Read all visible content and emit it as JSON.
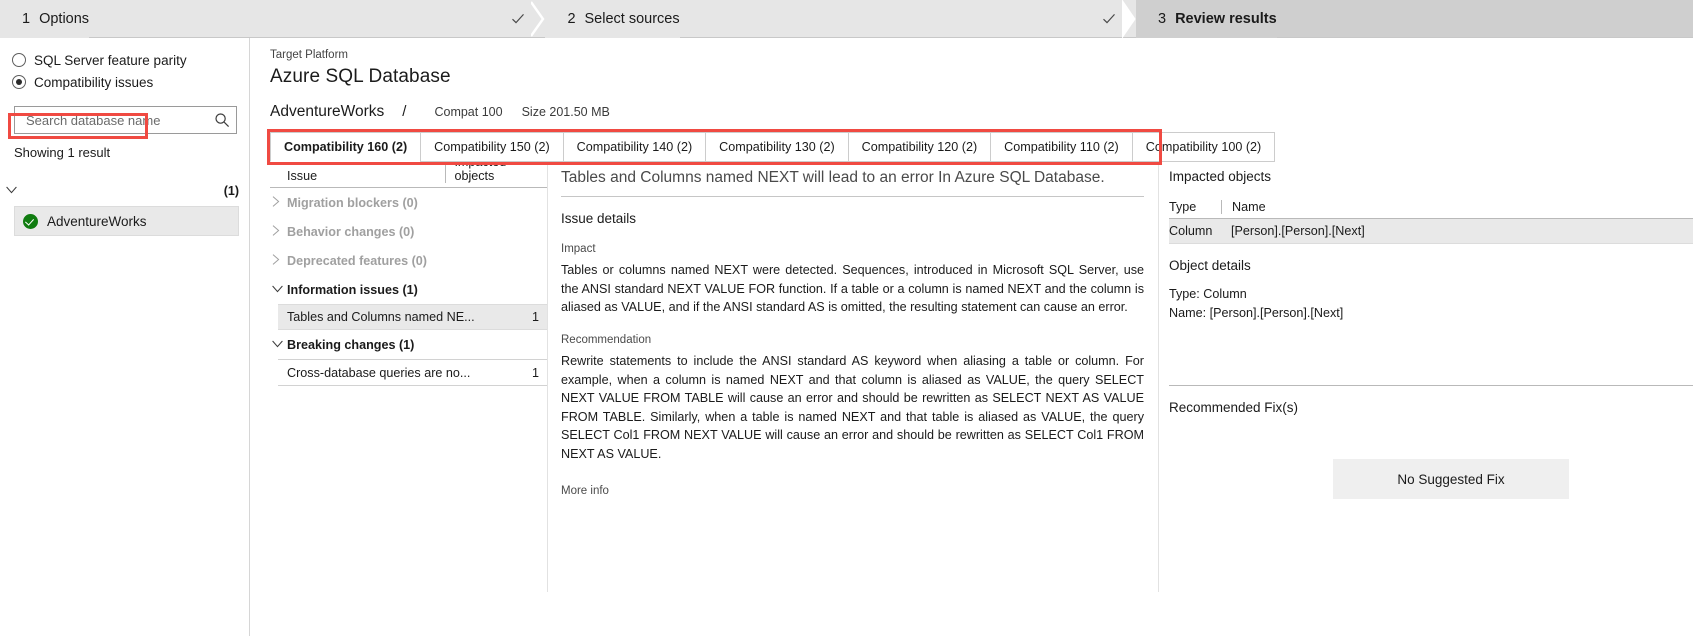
{
  "wizard": {
    "steps": [
      {
        "num": "1",
        "label": "Options",
        "active": false,
        "checked": true
      },
      {
        "num": "2",
        "label": "Select sources",
        "active": false,
        "checked": true
      },
      {
        "num": "3",
        "label": "Review results",
        "active": true,
        "checked": false
      }
    ]
  },
  "sidebar": {
    "radios": [
      {
        "label": "SQL Server feature parity",
        "selected": false
      },
      {
        "label": "Compatibility issues",
        "selected": true
      }
    ],
    "search": {
      "value": "",
      "placeholder": "Search database name",
      "icon": "search-icon"
    },
    "showing": "Showing 1 result",
    "group": {
      "name": "",
      "count": "(1)",
      "expanded": true
    },
    "databases": [
      {
        "name": "AdventureWorks",
        "status": "ok"
      }
    ]
  },
  "main": {
    "target_kicker": "Target Platform",
    "target_name": "Azure SQL Database",
    "db": {
      "name": "AdventureWorks",
      "separator": "/",
      "compat": "Compat 100",
      "size": "Size 201.50 MB"
    },
    "tabs": [
      {
        "label": "Compatibility 160 (2)",
        "active": true
      },
      {
        "label": "Compatibility 150 (2)",
        "active": false
      },
      {
        "label": "Compatibility 140 (2)",
        "active": false
      },
      {
        "label": "Compatibility 130 (2)",
        "active": false
      },
      {
        "label": "Compatibility 120 (2)",
        "active": false
      },
      {
        "label": "Compatibility 110 (2)",
        "active": false
      },
      {
        "label": "Compatibility 100 (2)",
        "active": false
      }
    ],
    "issues": {
      "col_issue": "Issue",
      "col_impacted": "Impacted objects",
      "categories": [
        {
          "label": "Migration blockers (0)",
          "expanded": false,
          "dim": true,
          "items": []
        },
        {
          "label": "Behavior changes (0)",
          "expanded": false,
          "dim": true,
          "items": []
        },
        {
          "label": "Deprecated features (0)",
          "expanded": false,
          "dim": true,
          "items": []
        },
        {
          "label": "Information issues (1)",
          "expanded": true,
          "dim": false,
          "items": [
            {
              "name": "Tables and Columns named NE...",
              "count": "1",
              "selected": true
            }
          ]
        },
        {
          "label": "Breaking changes (1)",
          "expanded": true,
          "dim": false,
          "items": [
            {
              "name": "Cross-database queries are no...",
              "count": "1",
              "selected": false
            }
          ]
        }
      ]
    },
    "detail": {
      "title": "Tables and Columns named NEXT will lead to an error In Azure SQL Database.",
      "section": "Issue details",
      "impact_label": "Impact",
      "impact_text": "Tables or columns named NEXT were detected. Sequences, introduced in Microsoft SQL Server, use the ANSI standard NEXT VALUE FOR function. If a table or a column is named NEXT and the column is aliased as VALUE, and if the ANSI standard AS is omitted, the resulting statement can cause an error.",
      "recommendation_label": "Recommendation",
      "recommendation_text": "Rewrite statements to include the ANSI standard AS keyword when aliasing a table or column. For example, when a column is named NEXT and that column is aliased as VALUE, the query SELECT NEXT VALUE FROM TABLE will cause an error and should be rewritten as SELECT NEXT AS VALUE FROM TABLE. Similarly, when a table is named NEXT and that table is aliased as VALUE, the query SELECT Col1 FROM NEXT VALUE will cause an error and should be rewritten as SELECT Col1 FROM NEXT AS VALUE.",
      "more_info": "More info"
    },
    "impacted": {
      "title": "Impacted objects",
      "col_type": "Type",
      "col_name": "Name",
      "rows": [
        {
          "type": "Column",
          "name": "[Person].[Person].[Next]",
          "selected": true
        }
      ],
      "object_details_title": "Object details",
      "object_type": "Type: Column",
      "object_name": "Name: [Person].[Person].[Next]",
      "fix_title": "Recommended Fix(s)",
      "no_fix": "No Suggested Fix"
    }
  },
  "highlights": {
    "accent": "#f04a42"
  }
}
